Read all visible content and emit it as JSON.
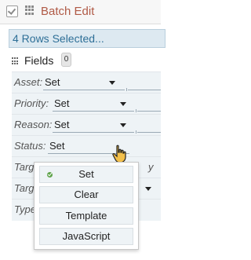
{
  "header": {
    "title": "Batch Edit"
  },
  "selection": {
    "text": "4 Rows Selected..."
  },
  "fields": {
    "label": "Fields",
    "count": "0",
    "rows": [
      {
        "label": "Asset:",
        "value": "Set"
      },
      {
        "label": "Priority:",
        "value": "Set"
      },
      {
        "label": "Reason:",
        "value": "Set"
      },
      {
        "label": "Status:",
        "value": "Set"
      }
    ],
    "partial_rows": [
      {
        "label": "Targ"
      },
      {
        "label": "Targ"
      },
      {
        "label": "Type"
      }
    ]
  },
  "dropdown": {
    "options": [
      "Set",
      "Clear",
      "Template",
      "JavaScript"
    ],
    "selected": "Set"
  },
  "colors": {
    "title": "#b05a46",
    "selected_bar_text": "#2e6f97",
    "selected_bar_bg": "#dde9f1",
    "check": "#5fa34b"
  },
  "icons": {
    "header_checkbox": "checkbox-icon",
    "header_grid": "grid-icon",
    "fields_grid": "grid-icon",
    "cursor": "hand-pointer-icon",
    "selected_option": "checkmark-icon"
  }
}
